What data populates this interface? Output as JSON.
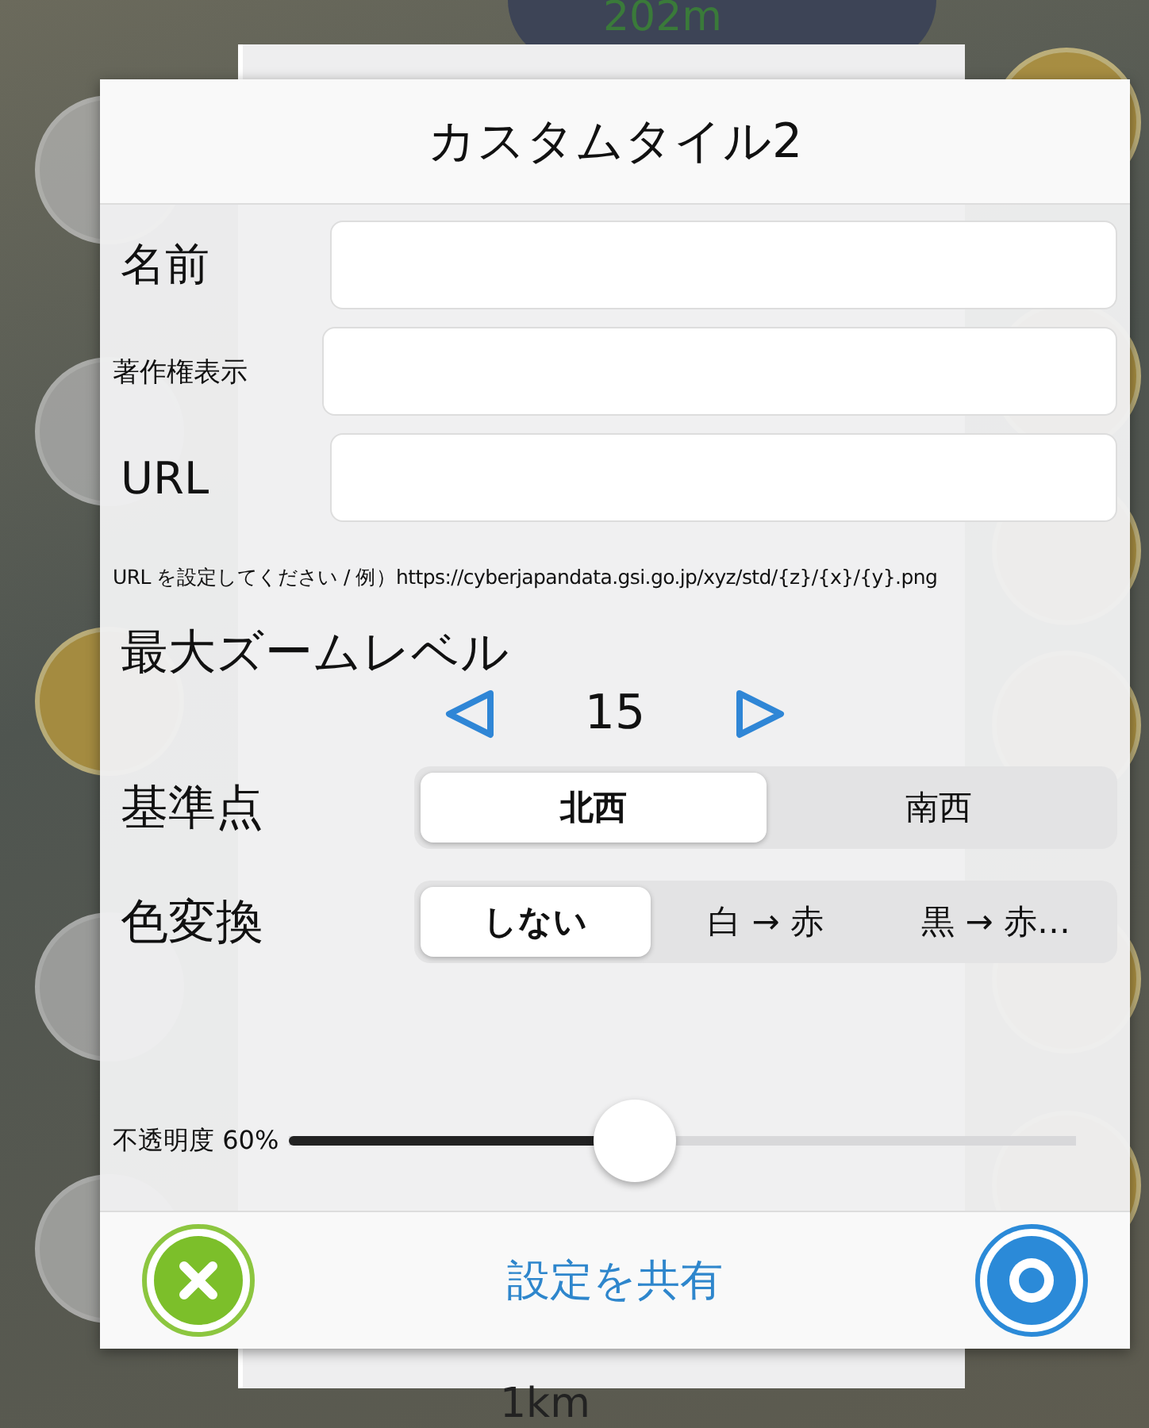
{
  "map": {
    "scale_top": "202m",
    "scale_bottom": "1km"
  },
  "dialog": {
    "title": "カスタムタイル2",
    "fields": [
      {
        "label": "名前"
      },
      {
        "label": "著作権表示"
      },
      {
        "label": "URL"
      }
    ],
    "hint": "URL を設定してください / 例）https://cyberjapandata.gsi.go.jp/xyz/std/{z}/{x}/{y}.png",
    "zoom": {
      "label": "最大ズームレベル",
      "value": "15"
    },
    "segments": [
      {
        "label": "基準点",
        "options": [
          {
            "label": "北西",
            "selected": true
          },
          {
            "label": "南西",
            "selected": false
          }
        ]
      },
      {
        "label": "色変換",
        "options": [
          {
            "label": "しない",
            "selected": true
          },
          {
            "label": "白 → 赤",
            "selected": false
          },
          {
            "label": "黒 → 赤…",
            "selected": false
          }
        ]
      }
    ],
    "opacity": {
      "label": "不透明度 60%",
      "level": 0.44
    },
    "footer": {
      "share": "設定を共有"
    }
  }
}
